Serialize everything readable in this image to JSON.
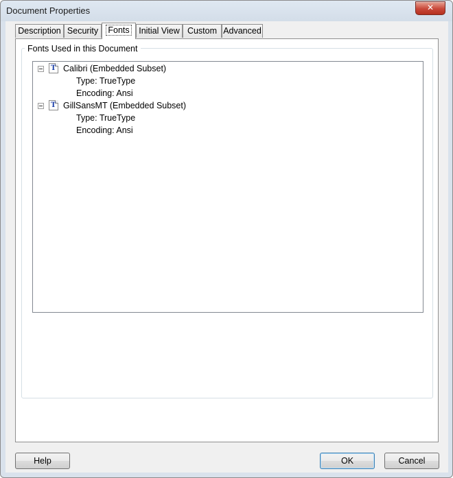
{
  "window": {
    "title": "Document Properties",
    "close_label": "✕"
  },
  "tabs": [
    {
      "label": "Description"
    },
    {
      "label": "Security"
    },
    {
      "label": "Fonts"
    },
    {
      "label": "Initial View"
    },
    {
      "label": "Custom"
    },
    {
      "label": "Advanced"
    }
  ],
  "active_tab": "Fonts",
  "fonts_group": {
    "legend": "Fonts Used in this Document",
    "fonts": [
      {
        "name": "Calibri (Embedded Subset)",
        "type": "Type: TrueType",
        "encoding": "Encoding: Ansi",
        "icon": "truetype-font-icon",
        "icon_glyph": "T"
      },
      {
        "name": "GillSansMT (Embedded Subset)",
        "type": "Type: TrueType",
        "encoding": "Encoding: Ansi",
        "icon": "truetype-font-icon",
        "icon_glyph": "T"
      }
    ]
  },
  "buttons": {
    "help": "Help",
    "ok": "OK",
    "cancel": "Cancel"
  }
}
